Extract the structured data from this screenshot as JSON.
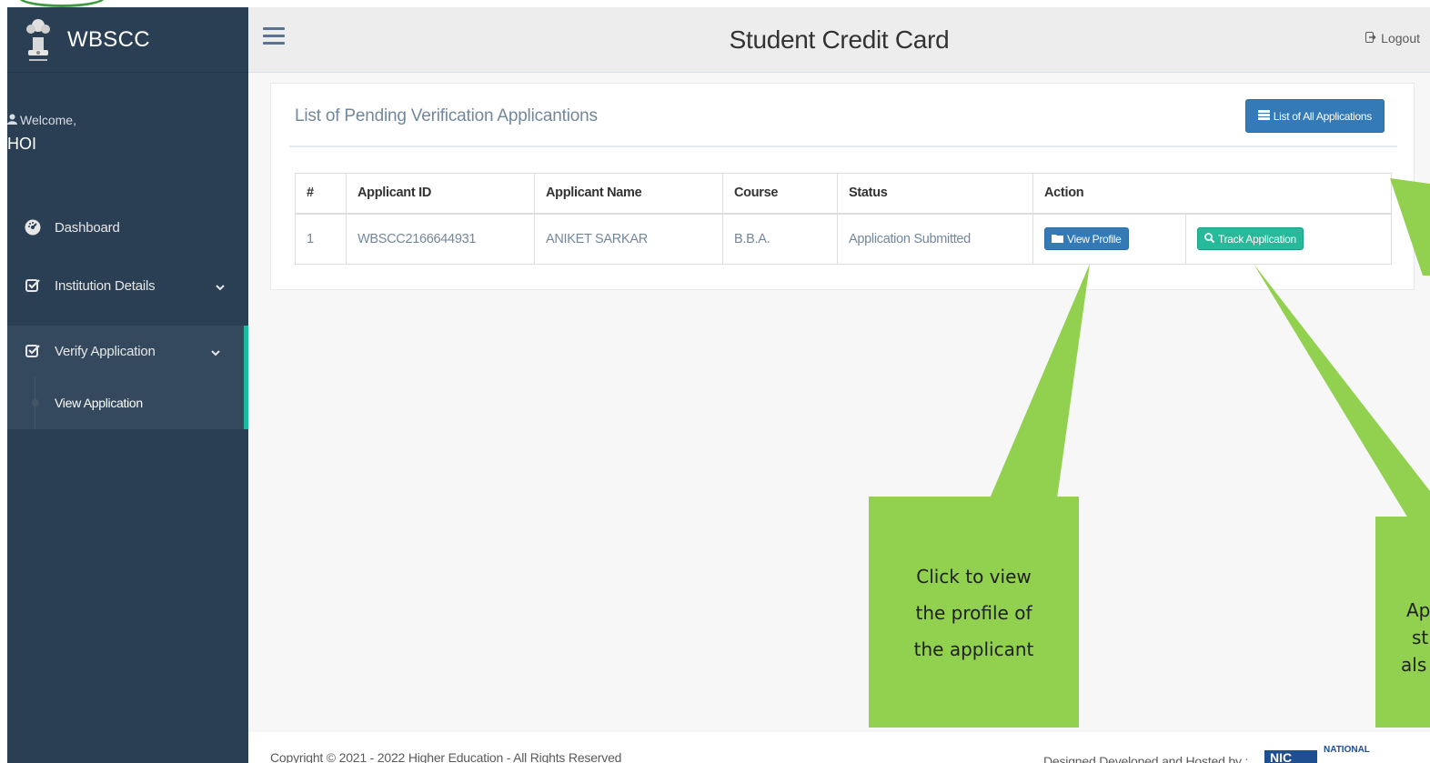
{
  "brand": {
    "name": "WBSCC"
  },
  "sidebar": {
    "welcome_label": "Welcome,",
    "user_name": "HOI",
    "items": [
      {
        "label": "Dashboard",
        "icon": "dashboard-icon"
      },
      {
        "label": "Institution Details",
        "icon": "checkbox-icon"
      },
      {
        "label": "Verify Application",
        "icon": "checkbox-icon"
      }
    ],
    "sub_items": [
      {
        "label": "View Application"
      }
    ]
  },
  "header": {
    "title": "Student Credit Card",
    "logout_label": "Logout"
  },
  "panel": {
    "title": "List of Pending Verification Applicantions",
    "all_applications_label": "List of All Applications"
  },
  "table": {
    "headers": [
      "#",
      "Applicant ID",
      "Applicant Name",
      "Course",
      "Status",
      "Action"
    ],
    "rows": [
      {
        "index": "1",
        "applicant_id": "WBSCC2166644931",
        "applicant_name": "ANIKET SARKAR",
        "course": "B.B.A.",
        "status": "Application Submitted",
        "view_label": "View Profile",
        "track_label": "Track Application"
      }
    ]
  },
  "callouts": {
    "view_profile": [
      "Click to view",
      "the profile of",
      "the applicant"
    ],
    "partial": [
      "Ap",
      "st",
      "als"
    ]
  },
  "footer": {
    "copyright": "Copyright © 2021 - 2022 Higher Education - All Rights Reserved",
    "designed": "Designed Developed and Hosted by :",
    "nic": "NATIONAL"
  },
  "colors": {
    "sidebar": "#2a3f54",
    "accent": "#1abb9c",
    "primary": "#337ab7",
    "success": "#26b99a",
    "callout": "#92d050"
  }
}
